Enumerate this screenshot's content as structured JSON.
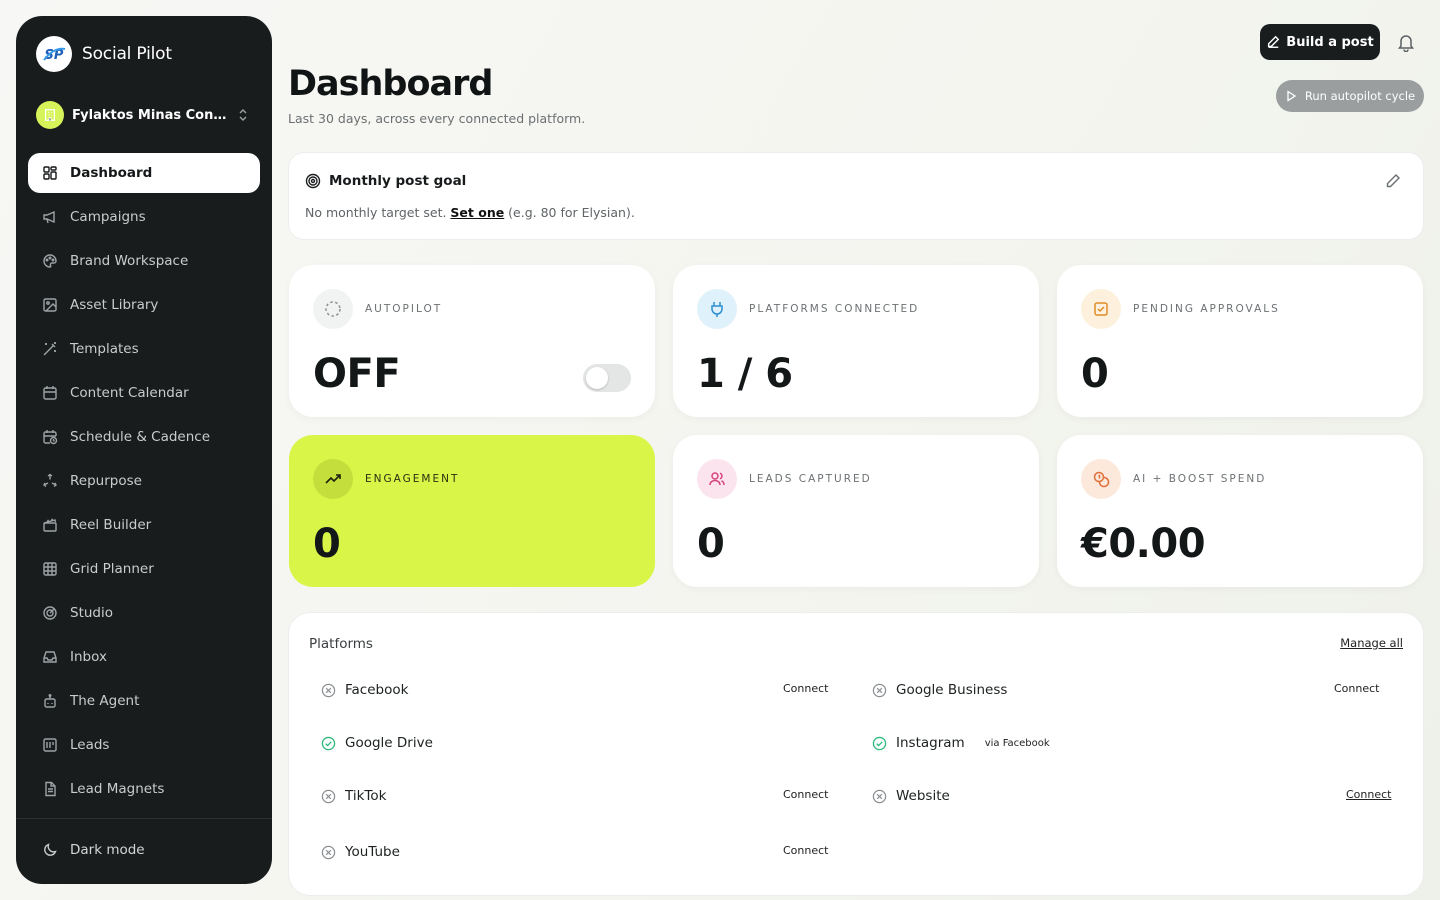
{
  "brand": {
    "name": "Social Pilot",
    "logo_text": "SP"
  },
  "workspace": {
    "name": "Fylaktos Minas Constru..."
  },
  "nav": {
    "items": [
      {
        "label": "Dashboard",
        "icon": "grid-icon"
      },
      {
        "label": "Campaigns",
        "icon": "megaphone-icon"
      },
      {
        "label": "Brand Workspace",
        "icon": "palette-icon"
      },
      {
        "label": "Asset Library",
        "icon": "image-icon"
      },
      {
        "label": "Templates",
        "icon": "magic-wand-icon"
      },
      {
        "label": "Content Calendar",
        "icon": "calendar-icon"
      },
      {
        "label": "Schedule & Cadence",
        "icon": "calendar-clock-icon"
      },
      {
        "label": "Repurpose",
        "icon": "recycle-icon"
      },
      {
        "label": "Reel Builder",
        "icon": "clapperboard-icon"
      },
      {
        "label": "Grid Planner",
        "icon": "grid-3x3-icon"
      },
      {
        "label": "Studio",
        "icon": "radar-icon"
      },
      {
        "label": "Inbox",
        "icon": "inbox-icon"
      },
      {
        "label": "The Agent",
        "icon": "bot-icon"
      },
      {
        "label": "Leads",
        "icon": "contact-card-icon"
      },
      {
        "label": "Lead Magnets",
        "icon": "document-icon"
      }
    ],
    "active": "Dashboard",
    "dark_mode_label": "Dark mode"
  },
  "header": {
    "title": "Dashboard",
    "subtitle": "Last 30 days, across every connected platform.",
    "build_post_label": "Build a post",
    "autopilot_label": "Run autopilot cycle"
  },
  "goal": {
    "title": "Monthly post goal",
    "text_before": "No monthly target set. ",
    "link": "Set one",
    "text_after": " (e.g. 80 for Elysian)."
  },
  "stats": [
    {
      "label": "AUTOPILOT",
      "value": "OFF",
      "icon": "loader-circle-icon",
      "icon_bg": "#f1f2f2"
    },
    {
      "label": "PLATFORMS CONNECTED",
      "value": "1 / 6",
      "icon": "plug-icon",
      "icon_bg": "#dff1fb"
    },
    {
      "label": "PENDING APPROVALS",
      "value": "0",
      "icon": "check-square-icon",
      "icon_bg": "#fdf0dc"
    },
    {
      "label": "ENGAGEMENT",
      "value": "0",
      "icon": "trending-up-icon",
      "icon_bg": "#c4de3c"
    },
    {
      "label": "LEADS CAPTURED",
      "value": "0",
      "icon": "users-icon",
      "icon_bg": "#fce4ee"
    },
    {
      "label": "AI + BOOST SPEND",
      "value": "€0.00",
      "icon": "coins-icon",
      "icon_bg": "#fde8dc"
    }
  ],
  "autopilot_on": false,
  "platforms": {
    "title": "Platforms",
    "manage_label": "Manage all",
    "items": [
      {
        "name": "Facebook",
        "connected": false,
        "action": "Connect",
        "via": ""
      },
      {
        "name": "Google Business",
        "connected": false,
        "action": "Connect",
        "via": ""
      },
      {
        "name": "Google Drive",
        "connected": true,
        "action": "",
        "via": ""
      },
      {
        "name": "Instagram",
        "connected": true,
        "action": "",
        "via": "via Facebook"
      },
      {
        "name": "TikTok",
        "connected": false,
        "action": "Connect",
        "via": ""
      },
      {
        "name": "Website",
        "connected": false,
        "action": "Connect",
        "via": ""
      },
      {
        "name": "YouTube",
        "connected": false,
        "action": "Connect",
        "via": ""
      }
    ]
  },
  "colors": {
    "accent_lime": "#d8f548",
    "sidebar_bg": "#191c1d",
    "connected_green": "#2fb97a",
    "disconnected_gray": "#8a8f91"
  }
}
